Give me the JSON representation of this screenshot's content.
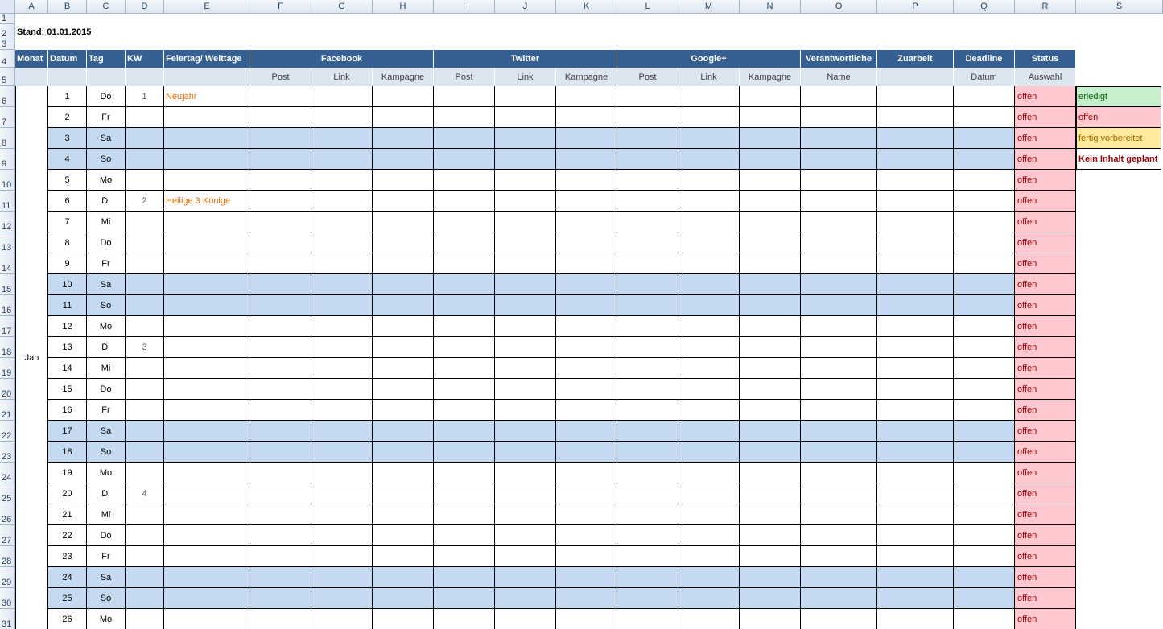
{
  "columns": [
    "A",
    "B",
    "C",
    "D",
    "E",
    "F",
    "G",
    "H",
    "I",
    "J",
    "K",
    "L",
    "M",
    "N",
    "O",
    "P",
    "Q",
    "R",
    "S"
  ],
  "row_numbers": [
    "1",
    "2",
    "3",
    "4",
    "5",
    "6",
    "7",
    "8",
    "9",
    "10",
    "11",
    "12",
    "13",
    "14",
    "15",
    "16",
    "17",
    "18",
    "19",
    "20",
    "21",
    "22",
    "23",
    "24",
    "25",
    "26",
    "27",
    "28",
    "29",
    "30",
    "31"
  ],
  "stand": "Stand: 01.01.2015",
  "headers": {
    "monat": "Monat",
    "datum": "Datum",
    "tag": "Tag",
    "kw": "KW",
    "feiertag": "Feiertag/ Welttage",
    "facebook": "Facebook",
    "twitter": "Twitter",
    "googleplus": "Google+",
    "verantwortliche": "Verantwortliche",
    "zuarbeit": "Zuarbeit",
    "deadline": "Deadline",
    "status": "Status"
  },
  "subheaders": {
    "post": "Post",
    "link": "Link",
    "kampagne": "Kampagne",
    "name": "Name",
    "datum": "Datum",
    "auswahl": "Auswahl"
  },
  "month": "Jan",
  "rows": [
    {
      "datum": "1",
      "tag": "Do",
      "kw": "1",
      "feiertag": "Neujahr",
      "status": "offen",
      "weekend": false
    },
    {
      "datum": "2",
      "tag": "Fr",
      "kw": "",
      "feiertag": "",
      "status": "offen",
      "weekend": false
    },
    {
      "datum": "3",
      "tag": "Sa",
      "kw": "",
      "feiertag": "",
      "status": "offen",
      "weekend": true
    },
    {
      "datum": "4",
      "tag": "So",
      "kw": "",
      "feiertag": "",
      "status": "offen",
      "weekend": true
    },
    {
      "datum": "5",
      "tag": "Mo",
      "kw": "",
      "feiertag": "",
      "status": "offen",
      "weekend": false
    },
    {
      "datum": "6",
      "tag": "Di",
      "kw": "2",
      "feiertag": "Heilige 3 Könige",
      "status": "offen",
      "weekend": false
    },
    {
      "datum": "7",
      "tag": "Mi",
      "kw": "",
      "feiertag": "",
      "status": "offen",
      "weekend": false
    },
    {
      "datum": "8",
      "tag": "Do",
      "kw": "",
      "feiertag": "",
      "status": "offen",
      "weekend": false
    },
    {
      "datum": "9",
      "tag": "Fr",
      "kw": "",
      "feiertag": "",
      "status": "offen",
      "weekend": false
    },
    {
      "datum": "10",
      "tag": "Sa",
      "kw": "",
      "feiertag": "",
      "status": "offen",
      "weekend": true
    },
    {
      "datum": "11",
      "tag": "So",
      "kw": "",
      "feiertag": "",
      "status": "offen",
      "weekend": true
    },
    {
      "datum": "12",
      "tag": "Mo",
      "kw": "",
      "feiertag": "",
      "status": "offen",
      "weekend": false
    },
    {
      "datum": "13",
      "tag": "Di",
      "kw": "3",
      "feiertag": "",
      "status": "offen",
      "weekend": false
    },
    {
      "datum": "14",
      "tag": "Mi",
      "kw": "",
      "feiertag": "",
      "status": "offen",
      "weekend": false
    },
    {
      "datum": "15",
      "tag": "Do",
      "kw": "",
      "feiertag": "",
      "status": "offen",
      "weekend": false
    },
    {
      "datum": "16",
      "tag": "Fr",
      "kw": "",
      "feiertag": "",
      "status": "offen",
      "weekend": false
    },
    {
      "datum": "17",
      "tag": "Sa",
      "kw": "",
      "feiertag": "",
      "status": "offen",
      "weekend": true
    },
    {
      "datum": "18",
      "tag": "So",
      "kw": "",
      "feiertag": "",
      "status": "offen",
      "weekend": true
    },
    {
      "datum": "19",
      "tag": "Mo",
      "kw": "",
      "feiertag": "",
      "status": "offen",
      "weekend": false
    },
    {
      "datum": "20",
      "tag": "Di",
      "kw": "4",
      "feiertag": "",
      "status": "offen",
      "weekend": false
    },
    {
      "datum": "21",
      "tag": "Mi",
      "kw": "",
      "feiertag": "",
      "status": "offen",
      "weekend": false
    },
    {
      "datum": "22",
      "tag": "Do",
      "kw": "",
      "feiertag": "",
      "status": "offen",
      "weekend": false
    },
    {
      "datum": "23",
      "tag": "Fr",
      "kw": "",
      "feiertag": "",
      "status": "offen",
      "weekend": false
    },
    {
      "datum": "24",
      "tag": "Sa",
      "kw": "",
      "feiertag": "",
      "status": "offen",
      "weekend": true
    },
    {
      "datum": "25",
      "tag": "So",
      "kw": "",
      "feiertag": "",
      "status": "offen",
      "weekend": true
    },
    {
      "datum": "26",
      "tag": "Mo",
      "kw": "",
      "feiertag": "",
      "status": "offen",
      "weekend": false
    }
  ],
  "legend": [
    {
      "label": "erledigt",
      "bg": "#c6efce",
      "color": "#006100",
      "bold": false
    },
    {
      "label": "offen",
      "bg": "#ffc7ce",
      "color": "#9c0006",
      "bold": false
    },
    {
      "label": "fertig vorbereitet",
      "bg": "#ffeb9c",
      "color": "#9c6500",
      "bold": false
    },
    {
      "label": "Kein Inhalt geplant",
      "bg": "#ffffff",
      "color": "#9c0006",
      "bold": true
    }
  ],
  "colors": {
    "header_bg": "#366092",
    "subheader_bg": "#dce6f1",
    "weekend_bg": "#c5d9f1",
    "status_bg": "#ffc7ce",
    "status_text": "#9c0006",
    "holiday_text": "#e26b0a"
  }
}
